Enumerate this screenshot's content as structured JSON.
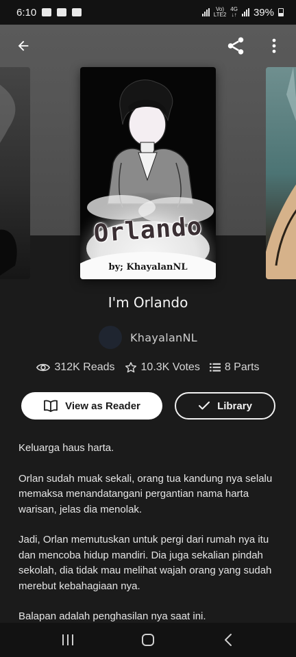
{
  "status_bar": {
    "time": "6:10",
    "battery_text": "39%",
    "icons": [
      "gallery-icon",
      "youtube-icon",
      "check-icon",
      "signal-icon",
      "lte-icon",
      "battery-icon"
    ],
    "lte_top": "Vo)",
    "lte_bottom": "LTE2",
    "net_top": "4G",
    "net_bottom": "↓↑"
  },
  "top_bar": {
    "icons": [
      "back-arrow-icon",
      "share-icon",
      "more-vert-icon"
    ]
  },
  "cover": {
    "title_art": "Orlando",
    "author_art": "by; KhayalanNL"
  },
  "story": {
    "title": "I'm Orlando",
    "author": "KhayalanNL"
  },
  "stats": {
    "reads": "312K Reads",
    "votes": "10.3K Votes",
    "parts": "8 Parts"
  },
  "buttons": {
    "reader_label": "View as Reader",
    "library_label": "Library"
  },
  "description": [
    "Keluarga haus harta.",
    "Orlan sudah muak sekali, orang tua kandung nya selalu memaksa menandatangani pergantian nama harta warisan, jelas dia menolak.",
    "Jadi, Orlan memutuskan untuk pergi dari rumah nya itu dan mencoba hidup mandiri. Dia juga sekalian pindah sekolah, dia tidak mau melihat wajah orang yang sudah merebut kebahagiaan nya.",
    "Balapan adalah penghasilan nya saat ini."
  ],
  "nav_bar": {
    "icons": [
      "recent-apps-icon",
      "home-icon",
      "back-icon"
    ]
  },
  "colors": {
    "background": "#1b1b1b",
    "accent_button": "#ffffff",
    "text": "#e6e6e6"
  }
}
